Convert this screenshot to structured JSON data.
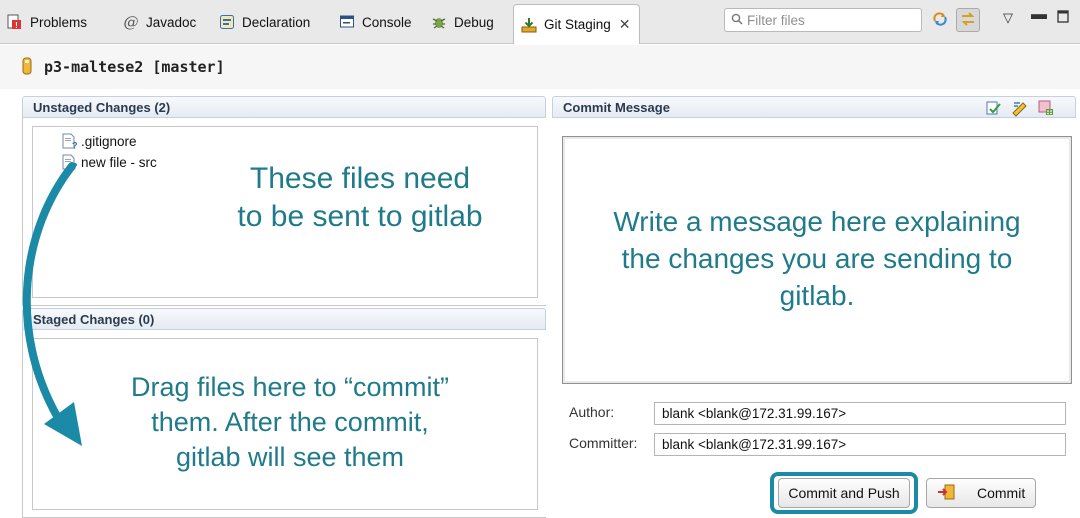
{
  "tabs": [
    {
      "label": "Problems",
      "icon": "problems-icon"
    },
    {
      "label": "Javadoc",
      "icon": "javadoc-icon"
    },
    {
      "label": "Declaration",
      "icon": "declaration-icon"
    },
    {
      "label": "Console",
      "icon": "console-icon"
    },
    {
      "label": "Debug",
      "icon": "debug-icon"
    },
    {
      "label": "Git Staging",
      "icon": "git-staging-icon",
      "active": true,
      "close": "✕"
    }
  ],
  "filter": {
    "placeholder": "Filter files"
  },
  "repository": {
    "label": "p3-maltese2 [master]"
  },
  "unstaged": {
    "header": "Unstaged Changes (2)",
    "files": [
      ".gitignore",
      "new file - src"
    ]
  },
  "staged": {
    "header": "Staged Changes (0)"
  },
  "commit_message": {
    "header": "Commit Message"
  },
  "author": {
    "label": "Author:",
    "value": "blank <blank@172.31.99.167>"
  },
  "committer": {
    "label": "Committer:",
    "value": "blank <blank@172.31.99.167>"
  },
  "buttons": {
    "commit_and_push": "Commit and Push",
    "commit": "Commit"
  },
  "annotations": {
    "unstaged_note_1": "These files need",
    "unstaged_note_2": "to be sent to gitlab",
    "message_note_1": "Write a message here explaining",
    "message_note_2": "the changes you are sending to",
    "message_note_3": "gitlab.",
    "staged_note_1": "Drag files here to “commit”",
    "staged_note_2": "them. After the commit,",
    "staged_note_3": "gitlab will see them"
  },
  "colors": {
    "annotation": "#1f7b8a",
    "highlight": "#1b8aa6"
  }
}
